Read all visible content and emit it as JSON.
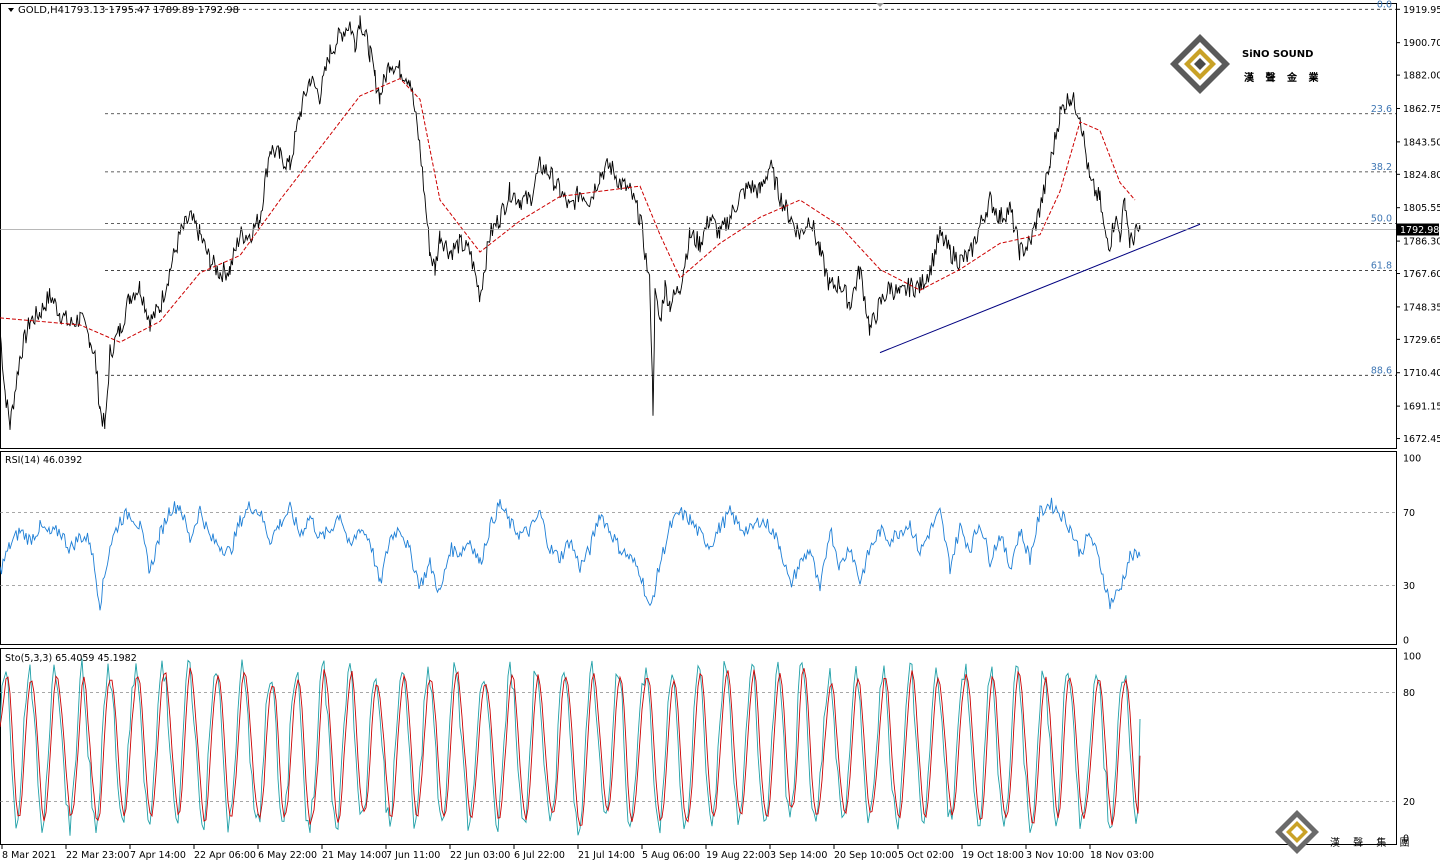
{
  "header": {
    "symbol_label": "GOLD,H4",
    "ohlc_label": "1793.13 1795.47 1789.89 1792.98"
  },
  "brand": {
    "name": "SiNO SOUND",
    "name_cn": "漢 聲 金 業",
    "watermark_cn": "漢 聲 集 團",
    "accent_color": "#c9a227",
    "dark_color": "#4a4a4a"
  },
  "chart_data": [
    {
      "type": "line",
      "id": "price",
      "series": [
        {
          "name": "GOLD,H4",
          "color": "#000000",
          "x": [
            0,
            5,
            10,
            20,
            30,
            40,
            50,
            60,
            70,
            80,
            90,
            95,
            100,
            105,
            110,
            120,
            130,
            140,
            150,
            160,
            170,
            180,
            190,
            200,
            210,
            220,
            230,
            240,
            250,
            260,
            270,
            280,
            290,
            300,
            310,
            320,
            330,
            340,
            350,
            355,
            360,
            365,
            370,
            375,
            380,
            390,
            400,
            410,
            420,
            430,
            435,
            440,
            450,
            460,
            470,
            480,
            490,
            500,
            510,
            520,
            530,
            540,
            550,
            560,
            570,
            580,
            590,
            600,
            610,
            620,
            630,
            640,
            650,
            653,
            655,
            660,
            665,
            670,
            680,
            690,
            700,
            710,
            720,
            730,
            740,
            750,
            760,
            770,
            780,
            790,
            800,
            810,
            820,
            830,
            840,
            850,
            860,
            870,
            880,
            890,
            900,
            910,
            920,
            930,
            940,
            950,
            960,
            970,
            980,
            990,
            1000,
            1010,
            1020,
            1030,
            1040,
            1050,
            1060,
            1065,
            1070,
            1080,
            1090,
            1100,
            1105,
            1110,
            1115,
            1120,
            1125,
            1130,
            1135,
            1140
          ],
          "y": [
            1735,
            1700,
            1680,
            1720,
            1740,
            1745,
            1755,
            1745,
            1738,
            1742,
            1730,
            1720,
            1690,
            1678,
            1722,
            1735,
            1755,
            1760,
            1740,
            1748,
            1770,
            1790,
            1800,
            1790,
            1775,
            1768,
            1770,
            1790,
            1790,
            1800,
            1840,
            1835,
            1830,
            1860,
            1880,
            1870,
            1895,
            1905,
            1912,
            1900,
            1915,
            1905,
            1895,
            1880,
            1870,
            1890,
            1885,
            1880,
            1840,
            1780,
            1770,
            1790,
            1780,
            1785,
            1780,
            1755,
            1790,
            1800,
            1815,
            1810,
            1810,
            1830,
            1825,
            1815,
            1805,
            1815,
            1810,
            1825,
            1830,
            1820,
            1815,
            1800,
            1760,
            1690,
            1755,
            1740,
            1760,
            1750,
            1760,
            1790,
            1785,
            1800,
            1790,
            1800,
            1812,
            1818,
            1815,
            1830,
            1812,
            1800,
            1790,
            1800,
            1780,
            1760,
            1762,
            1750,
            1770,
            1735,
            1750,
            1760,
            1755,
            1760,
            1760,
            1770,
            1790,
            1780,
            1775,
            1778,
            1795,
            1810,
            1800,
            1805,
            1780,
            1785,
            1805,
            1830,
            1860,
            1865,
            1870,
            1860,
            1820,
            1810,
            1790,
            1785,
            1800,
            1790,
            1810,
            1785,
            1790,
            1793
          ]
        },
        {
          "name": "",
          "color": "#cc0000",
          "dash": "4,2",
          "x": [
            0,
            40,
            80,
            120,
            160,
            200,
            240,
            280,
            320,
            360,
            400,
            420,
            440,
            480,
            520,
            560,
            600,
            640,
            660,
            680,
            720,
            760,
            800,
            840,
            880,
            920,
            960,
            1000,
            1040,
            1060,
            1080,
            1100,
            1120,
            1135
          ],
          "y": [
            1742,
            1740,
            1738,
            1728,
            1740,
            1768,
            1778,
            1810,
            1840,
            1870,
            1880,
            1868,
            1810,
            1780,
            1798,
            1812,
            1815,
            1818,
            1790,
            1765,
            1785,
            1800,
            1810,
            1795,
            1770,
            1758,
            1770,
            1785,
            1790,
            1815,
            1855,
            1850,
            1820,
            1810
          ]
        }
      ],
      "trendline": {
        "x": [
          880,
          1200
        ],
        "y": [
          1722,
          1796
        ],
        "color": "#000080"
      },
      "fib_levels": [
        {
          "label": "0.0",
          "value": 1919.95
        },
        {
          "label": "23.6",
          "value": 1859.7
        },
        {
          "label": "38.2",
          "value": 1826.2
        },
        {
          "label": "50.0",
          "value": 1796.5
        },
        {
          "label": "61.8",
          "value": 1769.3
        },
        {
          "label": "88.6",
          "value": 1708.9
        }
      ],
      "last_price": {
        "value": 1792.98,
        "label": "1792.98"
      },
      "yticks": [
        "1919.95",
        "1900.70",
        "1882.00",
        "1862.75",
        "1843.50",
        "1824.80",
        "1805.55",
        "1786.30",
        "1767.60",
        "1748.35",
        "1729.65",
        "1710.40",
        "1691.15",
        "1672.45"
      ],
      "ytick_values": [
        1919.95,
        1900.7,
        1882.0,
        1862.75,
        1843.5,
        1824.8,
        1805.55,
        1786.3,
        1767.6,
        1748.35,
        1729.65,
        1710.4,
        1691.15,
        1672.45
      ],
      "ylim": [
        1667,
        1923
      ],
      "xlim": [
        0,
        1396
      ]
    },
    {
      "type": "line",
      "id": "rsi",
      "title": "RSI(14) 46.0392",
      "series": [
        {
          "name": "RSI(14)",
          "color": "#1e7fd6",
          "x": [
            0,
            10,
            20,
            30,
            40,
            50,
            60,
            70,
            80,
            90,
            100,
            110,
            120,
            130,
            140,
            150,
            160,
            170,
            180,
            190,
            200,
            210,
            220,
            230,
            240,
            250,
            260,
            270,
            280,
            290,
            300,
            310,
            320,
            330,
            340,
            350,
            360,
            370,
            380,
            390,
            400,
            410,
            420,
            430,
            440,
            450,
            460,
            470,
            480,
            490,
            500,
            510,
            520,
            530,
            540,
            550,
            560,
            570,
            580,
            590,
            600,
            610,
            620,
            630,
            640,
            650,
            660,
            670,
            680,
            690,
            700,
            710,
            720,
            730,
            740,
            750,
            760,
            770,
            780,
            790,
            800,
            810,
            820,
            830,
            840,
            850,
            860,
            870,
            880,
            890,
            900,
            910,
            920,
            930,
            940,
            950,
            960,
            970,
            980,
            990,
            1000,
            1010,
            1020,
            1030,
            1040,
            1050,
            1060,
            1070,
            1080,
            1090,
            1100,
            1110,
            1120,
            1130,
            1140
          ],
          "y": [
            38,
            52,
            60,
            55,
            62,
            58,
            60,
            50,
            57,
            55,
            20,
            52,
            66,
            70,
            62,
            38,
            58,
            72,
            74,
            55,
            72,
            56,
            52,
            48,
            65,
            74,
            70,
            55,
            64,
            72,
            58,
            68,
            56,
            60,
            70,
            50,
            62,
            55,
            30,
            56,
            62,
            48,
            30,
            42,
            25,
            50,
            48,
            55,
            42,
            62,
            75,
            64,
            58,
            60,
            70,
            50,
            45,
            55,
            40,
            50,
            70,
            60,
            50,
            45,
            38,
            16,
            42,
            62,
            70,
            66,
            58,
            52,
            62,
            70,
            62,
            60,
            66,
            62,
            52,
            30,
            42,
            50,
            26,
            62,
            40,
            52,
            32,
            50,
            60,
            55,
            60,
            64,
            48,
            60,
            70,
            40,
            62,
            50,
            65,
            44,
            58,
            40,
            60,
            45,
            70,
            75,
            70,
            62,
            48,
            58,
            42,
            20,
            28,
            46,
            46
          ]
        }
      ],
      "levels": [
        70,
        30
      ],
      "yticks": [
        "100",
        "70",
        "30",
        "0"
      ],
      "ytick_values": [
        100,
        70,
        30,
        0
      ],
      "ylim": [
        0,
        100
      ],
      "xlim": [
        0,
        1396
      ]
    },
    {
      "type": "line",
      "id": "stochastic",
      "title": "Sto(5,3,3) 65.4059 45.1982",
      "series": [
        {
          "name": "%K",
          "color": "#20a0a8"
        },
        {
          "name": "%D",
          "color": "#cc0000"
        }
      ],
      "levels": [
        80,
        20
      ],
      "yticks": [
        "100",
        "80",
        "20",
        "0"
      ],
      "ytick_values": [
        100,
        80,
        20,
        0
      ],
      "ylim": [
        0,
        100
      ],
      "xlim": [
        0,
        1396
      ],
      "current_k": 65.4059,
      "current_d": 45.1982
    }
  ],
  "time_axis": {
    "labels": [
      "8 Mar 2021",
      "22 Mar 23:00",
      "7 Apr 14:00",
      "22 Apr 06:00",
      "6 May 22:00",
      "21 May 14:00",
      "7 Jun 11:00",
      "22 Jun 03:00",
      "6 Jul 22:00",
      "21 Jul 14:00",
      "5 Aug 06:00",
      "19 Aug 22:00",
      "3 Sep 14:00",
      "20 Sep 10:00",
      "5 Oct 02:00",
      "19 Oct 18:00",
      "3 Nov 10:00",
      "18 Nov 03:00"
    ],
    "positions": [
      0,
      64,
      128,
      192,
      256,
      320,
      384,
      448,
      512,
      576,
      640,
      704,
      768,
      832,
      896,
      960,
      1024,
      1088
    ]
  }
}
